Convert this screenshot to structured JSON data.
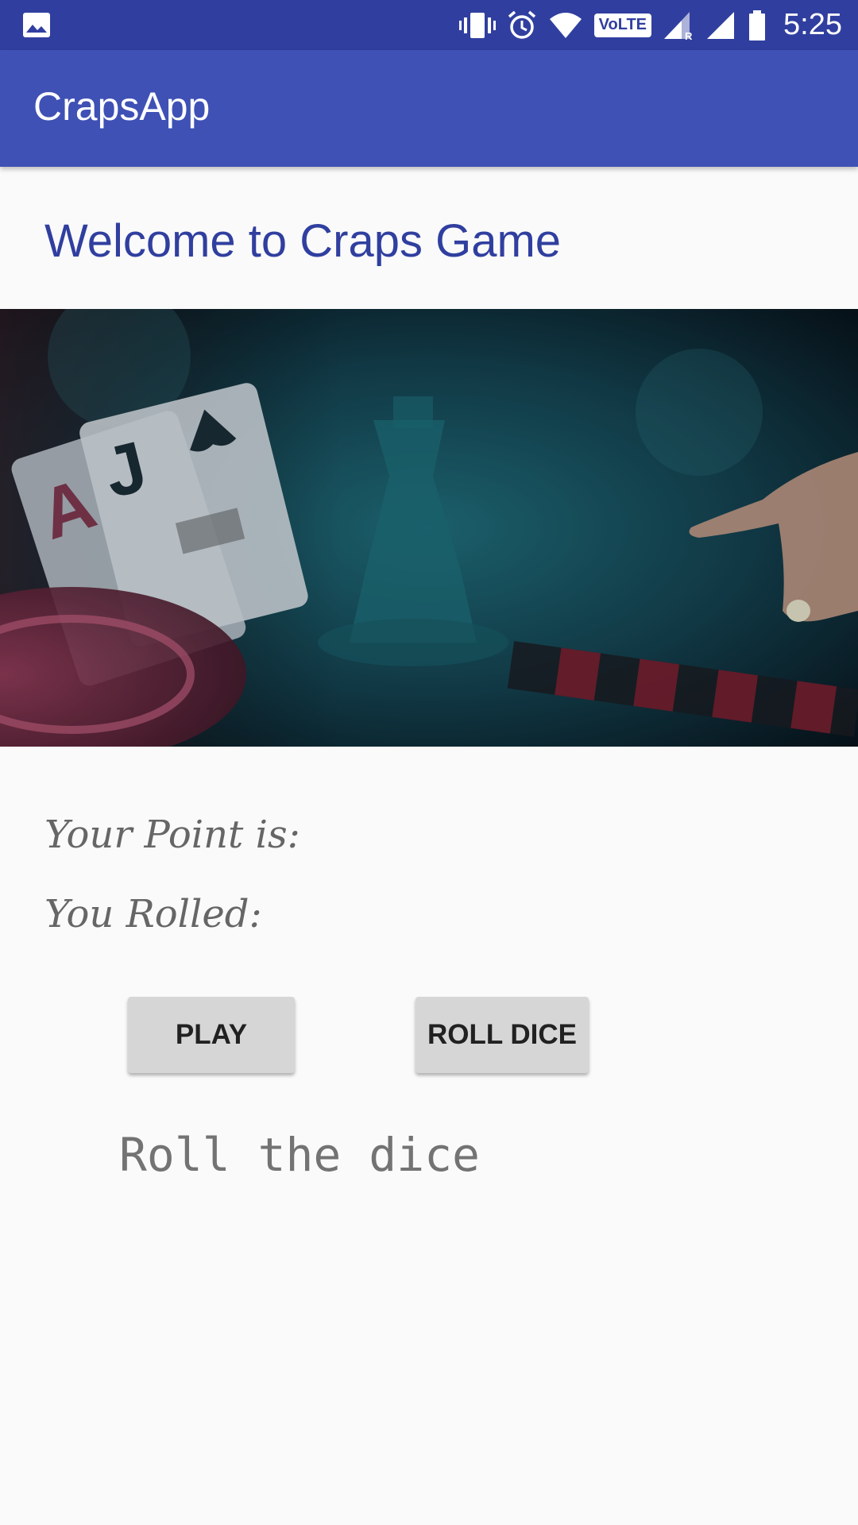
{
  "status_bar": {
    "time": "5:25",
    "volte_label": "VoLTE",
    "icons": [
      "gallery-icon",
      "vibrate-icon",
      "alarm-icon",
      "wifi-icon",
      "volte-icon",
      "signal-roaming-icon",
      "signal-icon",
      "battery-icon"
    ]
  },
  "app_bar": {
    "title": "CrapsApp"
  },
  "main": {
    "welcome": "Welcome to Craps Game",
    "hero_image": "casino-banner",
    "point_label": "Your Point is:",
    "rolled_label": "You Rolled:",
    "play_label": "PLAY",
    "roll_label": "ROLL DICE",
    "message": "Roll the dice"
  },
  "colors": {
    "status_bar": "#303f9f",
    "app_bar": "#3f51b5",
    "welcome_text": "#303f9f",
    "button_bg": "#d6d6d6",
    "background": "#fafafa"
  }
}
